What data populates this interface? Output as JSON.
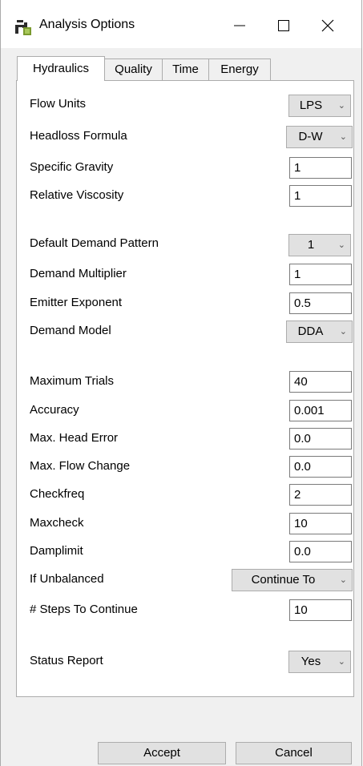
{
  "window": {
    "title": "Analysis Options",
    "minimize_glyph": "—",
    "maximize_glyph": "☐",
    "close_glyph": "✕"
  },
  "tabs": [
    {
      "label": "Hydraulics",
      "active": true
    },
    {
      "label": "Quality",
      "active": false
    },
    {
      "label": "Time",
      "active": false
    },
    {
      "label": "Energy",
      "active": false
    }
  ],
  "fields": {
    "flow_units": {
      "label": "Flow Units",
      "value": "LPS"
    },
    "headloss_formula": {
      "label": "Headloss Formula",
      "value": "D-W"
    },
    "specific_gravity": {
      "label": "Specific Gravity",
      "value": "1"
    },
    "relative_viscosity": {
      "label": "Relative Viscosity",
      "value": "1"
    },
    "default_demand_pattern": {
      "label": "Default Demand Pattern",
      "value": "1"
    },
    "demand_multiplier": {
      "label": "Demand Multiplier",
      "value": "1"
    },
    "emitter_exponent": {
      "label": "Emitter Exponent",
      "value": "0.5"
    },
    "demand_model": {
      "label": "Demand Model",
      "value": "DDA"
    },
    "maximum_trials": {
      "label": "Maximum Trials",
      "value": "40"
    },
    "accuracy": {
      "label": "Accuracy",
      "value": "0.001"
    },
    "max_head_error": {
      "label": "Max. Head Error",
      "value": "0.0"
    },
    "max_flow_change": {
      "label": "Max. Flow Change",
      "value": "0.0"
    },
    "checkfreq": {
      "label": "Checkfreq",
      "value": "2"
    },
    "maxcheck": {
      "label": "Maxcheck",
      "value": "10"
    },
    "damplimit": {
      "label": "Damplimit",
      "value": "0.0"
    },
    "if_unbalanced": {
      "label": "If Unbalanced",
      "value": "Continue To"
    },
    "steps_to_continue": {
      "label": "# Steps To Continue",
      "value": "10"
    },
    "status_report": {
      "label": "Status Report",
      "value": "Yes"
    }
  },
  "buttons": {
    "accept": "Accept",
    "cancel": "Cancel"
  },
  "colors": {
    "window_bg": "#f0f0f0",
    "panel_bg": "#ffffff",
    "control_bg": "#e1e1e1"
  },
  "icons": {
    "app": "faucet-icon",
    "dropdown": "chevron-down-icon"
  }
}
